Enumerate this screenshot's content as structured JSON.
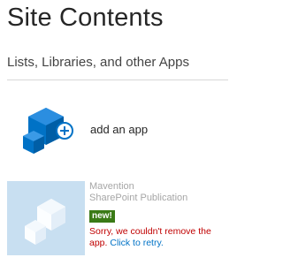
{
  "page": {
    "title": "Site Contents"
  },
  "section": {
    "title": "Lists, Libraries, and other Apps"
  },
  "add_app": {
    "label": "add an app",
    "icon": "add-app-icon"
  },
  "app": {
    "name": "Mavention",
    "subtitle": "SharePoint Publication",
    "badge": "new!",
    "error_text": "Sorry, we couldn't remove the app.",
    "retry_link": "Click to retry.",
    "icon": "app-cube-icon"
  },
  "colors": {
    "accent": "#0072c6",
    "tile_background": "#c8dff1",
    "badge_background": "#3a7a16",
    "error": "#c00000"
  }
}
